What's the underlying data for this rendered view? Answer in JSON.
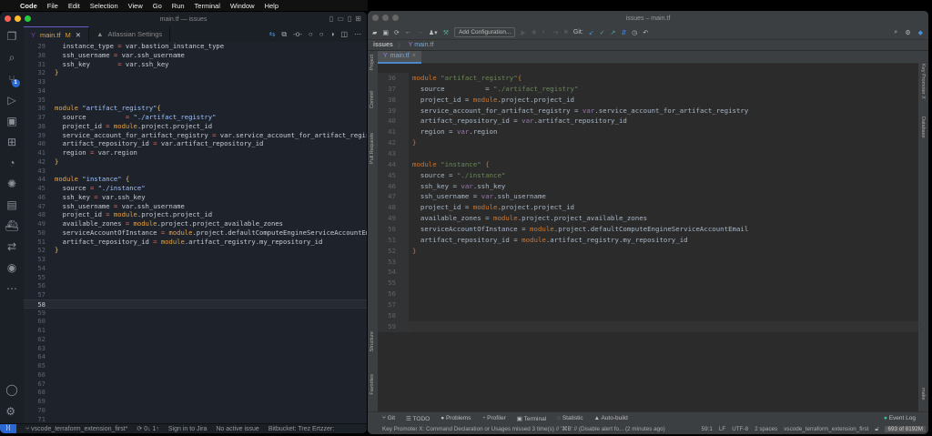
{
  "menubar": {
    "app": "Code",
    "items": [
      "File",
      "Edit",
      "Selection",
      "View",
      "Go",
      "Run",
      "Terminal",
      "Window",
      "Help"
    ]
  },
  "vscode": {
    "title": "main.tf — issues",
    "tabs": [
      {
        "label": "main.tf",
        "badge": "M"
      },
      {
        "label": "Atlassian Settings"
      }
    ],
    "scm_badge": "1",
    "first_line": 29,
    "current_line": 58,
    "lines": [
      "  instance_type = var.bastion_instance_type",
      "  ssh_username = var.ssh_username",
      "  ssh_key       = var.ssh_key",
      "}",
      "",
      "",
      "",
      "module \"artifact_registry\"{",
      "  source          = \"./artifact_registry\"",
      "  project_id = module.project.project_id",
      "  service_account_for_artifact_registry = var.service_account_for_artifact_registry",
      "  artifact_repository_id = var.artifact_repository_id",
      "  region = var.region",
      "}",
      "",
      "module \"instance\" {",
      "  source = \"./instance\"",
      "  ssh_key = var.ssh_key",
      "  ssh_username = var.ssh_username",
      "  project_id = module.project.project_id",
      "  available_zones = module.project.project_available_zones",
      "  serviceAccountOfInstance = module.project.defaultComputeEngineServiceAccountEmail",
      "  artifact_repository_id = module.artifact_registry.my_repository_id",
      "}",
      "",
      "",
      "",
      "",
      "",
      "",
      "",
      "",
      "",
      "",
      "",
      "",
      "",
      "",
      "",
      "",
      "",
      "",
      ""
    ],
    "status": {
      "branch": "vscode_terraform_extension_first*",
      "sync": "0↓ 1↑",
      "jira": "Sign in to Jira",
      "issue": "No active issue",
      "bitbucket": "Bitbucket: Trez Ertzzer:"
    }
  },
  "intellij": {
    "title": "issues – main.tf",
    "toolbar": {
      "add_config": "Add Configuration...",
      "git": "Git:"
    },
    "breadcrumb": [
      "issues",
      "main.tf"
    ],
    "tab": "main.tf",
    "left_tools": [
      "Project",
      "Commit",
      "Pull Requests",
      "Structure",
      "Favorites"
    ],
    "right_tools": [
      "Key Promoter X",
      "Database",
      "make"
    ],
    "first_line": 36,
    "current_line": 59,
    "lines": [
      "module \"artifact_registry\"{",
      "  source          = \"./artifact_registry\"",
      "  project_id = module.project.project_id",
      "  service_account_for_artifact_registry = var.service_account_for_artifact_registry",
      "  artifact_repository_id = var.artifact_repository_id",
      "  region = var.region",
      "}",
      "",
      "module \"instance\" {",
      "  source = \"./instance\"",
      "  ssh_key = var.ssh_key",
      "  ssh_username = var.ssh_username",
      "  project_id = module.project.project_id",
      "  available_zones = module.project.project_available_zones",
      "  serviceAccountOfInstance = module.project.defaultComputeEngineServiceAccountEmail",
      "  artifact_repository_id = module.artifact_registry.my_repository_id",
      "}",
      "",
      "",
      "",
      "",
      "",
      "",
      ""
    ],
    "tool_windows": [
      "Git",
      "TODO",
      "Problems",
      "Profiler",
      "Terminal",
      "Statistic",
      "Auto-build"
    ],
    "event_log": "Event Log",
    "status": {
      "message": "Key Promoter X: Command Declaration or Usages missed 3 time(s) // '⌘B' // (Disable alert fo... (2 minutes ago)",
      "position": "59:1",
      "line_sep": "LF",
      "encoding": "UTF-8",
      "indent": "2 spaces",
      "branch": "vscode_terraform_extension_first",
      "memory": "693 of 8192M"
    }
  }
}
